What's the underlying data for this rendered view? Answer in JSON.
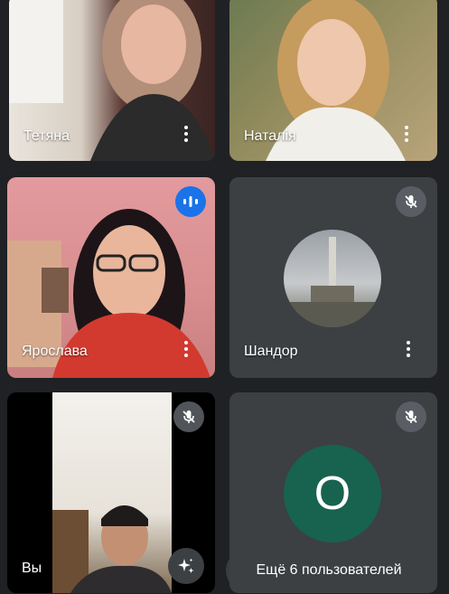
{
  "participants": [
    {
      "name": "Тетяна"
    },
    {
      "name": "Наталія"
    },
    {
      "name": "Ярослава"
    },
    {
      "name": "Шандор"
    },
    {
      "name": "Вы"
    },
    {
      "name": "",
      "initial": "О"
    }
  ],
  "more_users_label": "Ещё 6 пользователей",
  "colors": {
    "background": "#202124",
    "tile": "#3c4043",
    "speaking_indicator": "#1a73e8",
    "avatar_green": "#17634f"
  }
}
